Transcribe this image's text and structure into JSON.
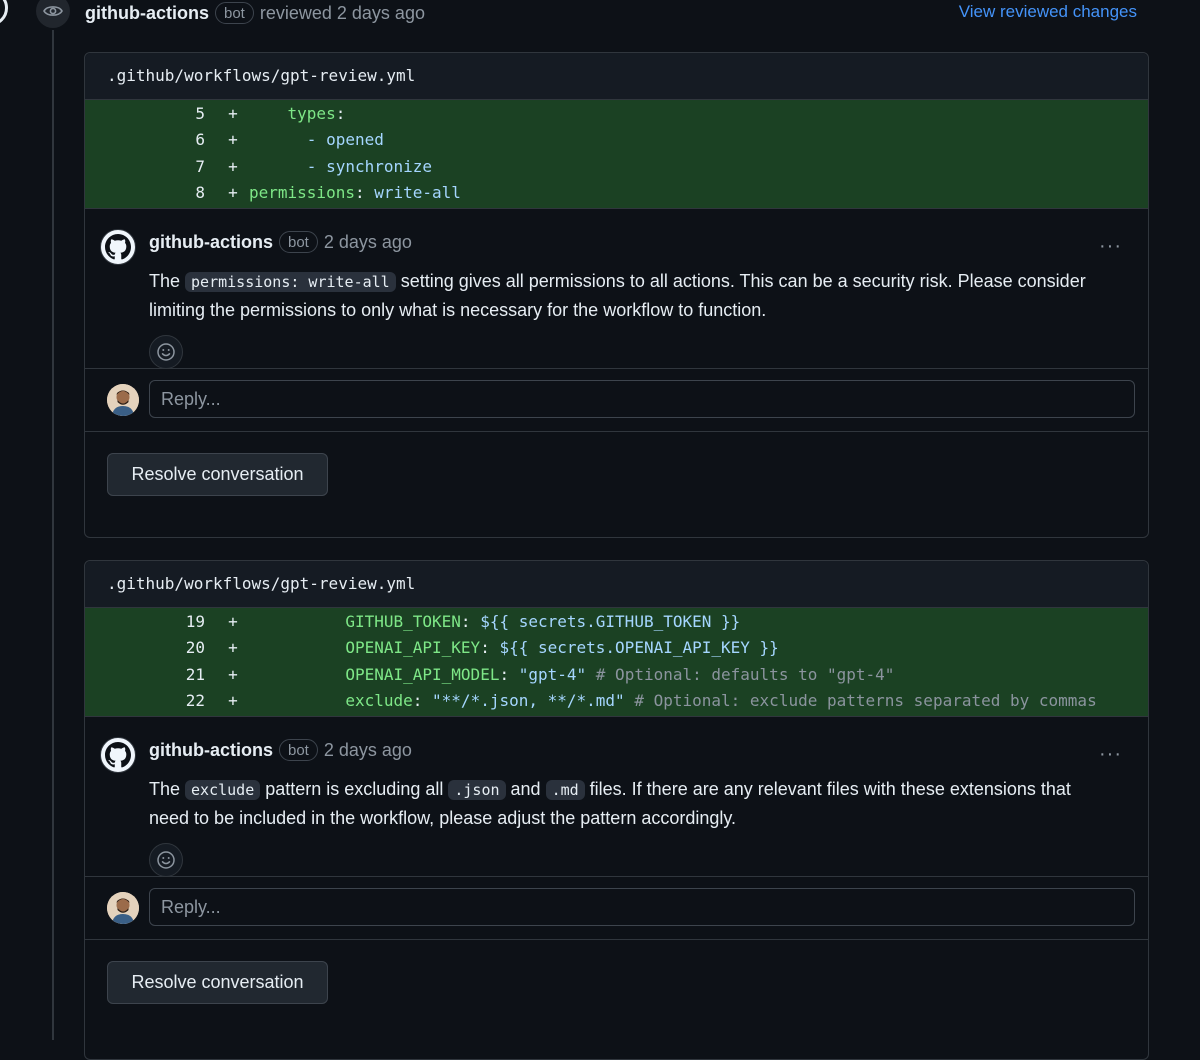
{
  "review": {
    "author": "github-actions",
    "badge": "bot",
    "action": "reviewed 2 days ago",
    "view_changes": "View reviewed changes"
  },
  "threads": [
    {
      "file": ".github/workflows/gpt-review.yml",
      "comment": {
        "author": "github-actions",
        "badge": "bot",
        "time": "2 days ago",
        "more": "···",
        "body_1": "The ",
        "code_1": "permissions: write-all",
        "body_2": " setting gives all permissions to all actions. This can be a security risk. Please consider limiting the permissions to only what is necessary for the workflow to function."
      },
      "reply_placeholder": "Reply...",
      "resolve_label": "Resolve conversation"
    },
    {
      "file": ".github/workflows/gpt-review.yml",
      "comment": {
        "author": "github-actions",
        "badge": "bot",
        "time": "2 days ago",
        "more": "···",
        "body_1": "The ",
        "code_1": "exclude",
        "body_2": " pattern is excluding all ",
        "code_2": ".json",
        "body_3": " and ",
        "code_3": ".md",
        "body_4": " files. If there are any relevant files with these extensions that need to be included in the workflow, please adjust the pattern accordingly."
      },
      "reply_placeholder": "Reply...",
      "resolve_label": "Resolve conversation"
    }
  ],
  "diff1": [
    {
      "ln": "5",
      "sign": "+",
      "indent": "    ",
      "key": "types",
      "sep": ":",
      "val": "",
      "comment": ""
    },
    {
      "ln": "6",
      "sign": "+",
      "indent": "      ",
      "key": "",
      "sep": "",
      "val": "- opened",
      "comment": ""
    },
    {
      "ln": "7",
      "sign": "+",
      "indent": "      ",
      "key": "",
      "sep": "",
      "val": "- synchronize",
      "comment": ""
    },
    {
      "ln": "8",
      "sign": "+",
      "indent": "",
      "key": "permissions",
      "sep": ": ",
      "val": "write-all",
      "comment": ""
    }
  ],
  "diff2": [
    {
      "ln": "19",
      "sign": "+",
      "indent": "          ",
      "key": "GITHUB_TOKEN",
      "sep": ": ",
      "val": "${{ secrets.GITHUB_TOKEN }}",
      "comment": ""
    },
    {
      "ln": "20",
      "sign": "+",
      "indent": "          ",
      "key": "OPENAI_API_KEY",
      "sep": ": ",
      "val": "${{ secrets.OPENAI_API_KEY }}",
      "comment": ""
    },
    {
      "ln": "21",
      "sign": "+",
      "indent": "          ",
      "key": "OPENAI_API_MODEL",
      "sep": ": ",
      "val": "\"gpt-4\"",
      "comment": " # Optional: defaults to \"gpt-4\""
    },
    {
      "ln": "22",
      "sign": "+",
      "indent": "          ",
      "key": "exclude",
      "sep": ": ",
      "val": "\"**/*.json, **/*.md\"",
      "comment": " # Optional: exclude patterns separated by commas"
    }
  ],
  "colors": {
    "background": "#0d1117",
    "diff_added_bg": "#1b4123",
    "link": "#4493f8",
    "yaml_key": "#7ee787",
    "yaml_string": "#a5d6ff",
    "yaml_comment": "#8b949e"
  },
  "icons": {
    "eye": "eye-icon",
    "github": "github-mark-icon",
    "smiley": "smiley-icon",
    "kebab": "kebab-horizontal-icon"
  }
}
